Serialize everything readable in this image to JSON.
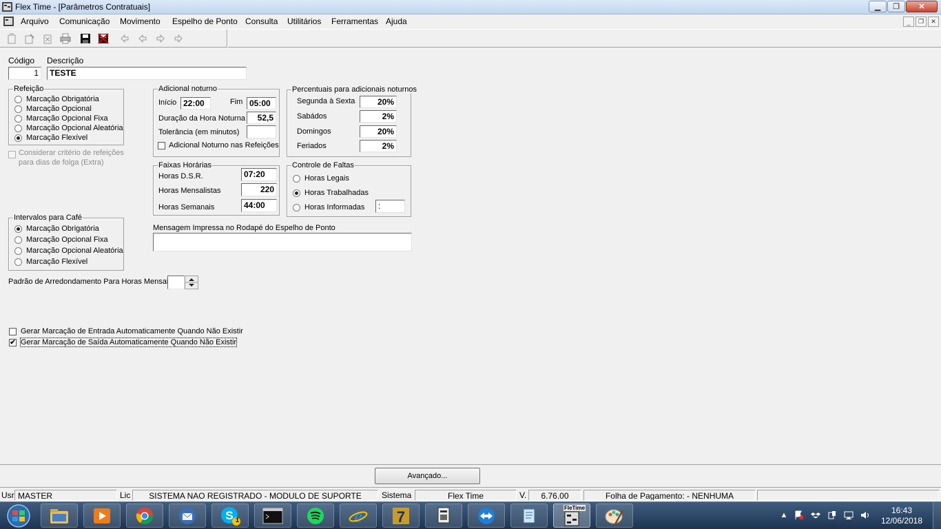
{
  "window": {
    "title": "Flex Time - [Parâmetros Contratuais]",
    "controls": {
      "minimize": "▁",
      "maximize": "❐",
      "close": "✕"
    }
  },
  "menu": {
    "items": [
      "Arquivo",
      "Comunicação",
      "Movimento",
      "Espelho de Ponto",
      "Consulta",
      "Utilitários",
      "Ferramentas",
      "Ajuda"
    ],
    "mdi_controls": {
      "minimize": "_",
      "restore": "❐",
      "close": "✕"
    }
  },
  "toolbar": {
    "icons": [
      "new-record-icon",
      "edit-record-icon",
      "delete-record-icon",
      "print-icon",
      "save-icon",
      "cancel-icon",
      "first-icon",
      "previous-icon",
      "next-icon",
      "last-icon"
    ]
  },
  "form": {
    "codigo": {
      "label": "Código",
      "value": "1"
    },
    "descricao": {
      "label": "Descrição",
      "value": "TESTE"
    },
    "refeicao": {
      "legend": "Refeição",
      "options": [
        "Marcação Obrigatória",
        "Marcação Opcional",
        "Marcação Opcional Fixa",
        "Marcação Opcional Aleatória",
        "Marcação Flexível"
      ],
      "selected": "Marcação Flexível"
    },
    "folga_check": {
      "line1": "Considerar critério de refeições",
      "line2": "para dias de folga (Extra)",
      "checked": false,
      "enabled": false
    },
    "adicional_noturno": {
      "legend": "Adicional noturno",
      "inicio_label": "Início",
      "inicio_value": "22:00",
      "fim_label": "Fim",
      "fim_value": "05:00",
      "duracao_label": "Duração da Hora Noturna",
      "duracao_value": "52,5",
      "tolerancia_label": "Tolerância (em minutos)",
      "tolerancia_value": "",
      "refeicoes_check_label": "Adicional Noturno nas Refeições",
      "refeicoes_checked": false
    },
    "percentuais": {
      "legend": "Percentuais para adicionais noturnos",
      "rows": [
        {
          "label": "Segunda à Sexta",
          "value": "20%"
        },
        {
          "label": "Sabádos",
          "value": "2%"
        },
        {
          "label": "Domingos",
          "value": "20%"
        },
        {
          "label": "Feriados",
          "value": "2%"
        }
      ]
    },
    "faixas": {
      "legend": "Faixas Horárias",
      "dsr_label": "Horas D.S.R.",
      "dsr_value": "07:20",
      "mensalistas_label": "Horas Mensalistas",
      "mensalistas_value": "220",
      "semanais_label": "Horas Semanais",
      "semanais_value": "44:00"
    },
    "faltas": {
      "legend": "Controle de Faltas",
      "options": [
        "Horas Legais",
        "Horas Trabalhadas",
        "Horas Informadas"
      ],
      "selected": "Horas Trabalhadas",
      "informadas_value": ":"
    },
    "cafe": {
      "legend": "Intervalos para Café",
      "options": [
        "Marcação Obrigatória",
        "Marcação Opcional Fixa",
        "Marcação Opcional Aleatória",
        "Marcação Flexível"
      ],
      "selected": "Marcação Obrigatória"
    },
    "mensagem": {
      "label": "Mensagem Impressa no Rodapé do Espelho de Ponto",
      "value": ""
    },
    "arredondamento": {
      "label": "Padrão de Arredondamento Para Horas Mensais",
      "value": ""
    },
    "gerar_entrada": {
      "label": "Gerar Marcação de Entrada Automaticamente Quando Não Existir",
      "checked": false
    },
    "gerar_saida": {
      "label": "Gerar Marcação de Saída Automaticamente Quando Não Existir",
      "checked": true
    },
    "advanced_button": "Avançado..."
  },
  "statusbar": {
    "usr_label": "Usr",
    "usr_value": "MASTER",
    "lic_label": "Lic",
    "lic_value": "SISTEMA NAO REGISTRADO - MODULO DE SUPORTE",
    "sistema_label": "Sistema",
    "sistema_value": "Flex Time",
    "version_label": "V.",
    "version_value": "6.76.00",
    "folha": "Folha de Pagamento:  - NENHUMA"
  },
  "taskbar": {
    "apps": [
      "explorer-icon",
      "media-player-icon",
      "chrome-icon",
      "thunderbird-icon",
      "skype-icon",
      "cmd-icon",
      "spotify-icon",
      "internet-explorer-icon",
      "7zip-icon",
      "remote-app-icon",
      "teamviewer-icon",
      "notepad-icon",
      "flex-time-icon",
      "paint-icon"
    ],
    "skype_badge": "1",
    "flex_label": "FleTime",
    "time": "16:43",
    "date": "12/06/2018"
  },
  "colors": {
    "accent": "#1e3f66",
    "window_bg": "#f0f0f0",
    "taskbar": "#1d3552"
  }
}
